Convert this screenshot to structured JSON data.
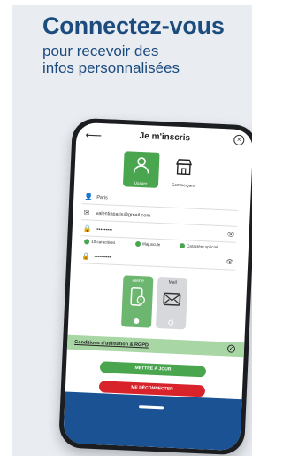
{
  "headline": "Connectez-vous",
  "subline_1": "pour recevoir des",
  "subline_2": "infos personnalisées",
  "app": {
    "title": "Je m'inscris",
    "roles": [
      {
        "label": "Usager",
        "selected": true
      },
      {
        "label": "Commerçant",
        "selected": false
      }
    ],
    "fields": [
      {
        "name": "city",
        "icon": "user-icon",
        "value": "Paris"
      },
      {
        "name": "email",
        "icon": "mail-icon",
        "value": "valentinparis@gmail.com"
      },
      {
        "name": "password",
        "icon": "lock-icon",
        "value": "••••••••••"
      },
      {
        "name": "password-confirm",
        "icon": "lock-icon",
        "value": "••••••••••"
      }
    ],
    "password_rules": [
      "10 caractères",
      "Majuscule",
      "Caractère spécial"
    ],
    "verification": [
      {
        "label": "Mail",
        "selected": false
      },
      {
        "label": "Mail",
        "selected": false
      }
    ],
    "verification_active_label": "Alerte",
    "conditions_label": "Conditions d'utilisation & RGPD",
    "update_button": "METTRE À JOUR",
    "logout_button": "ME DÉCONNECTER"
  },
  "colors": {
    "brand_blue": "#1c4b7e",
    "accent_green": "#4aa64e",
    "danger_red": "#d8232a",
    "bottom_blue": "#1a5294"
  }
}
